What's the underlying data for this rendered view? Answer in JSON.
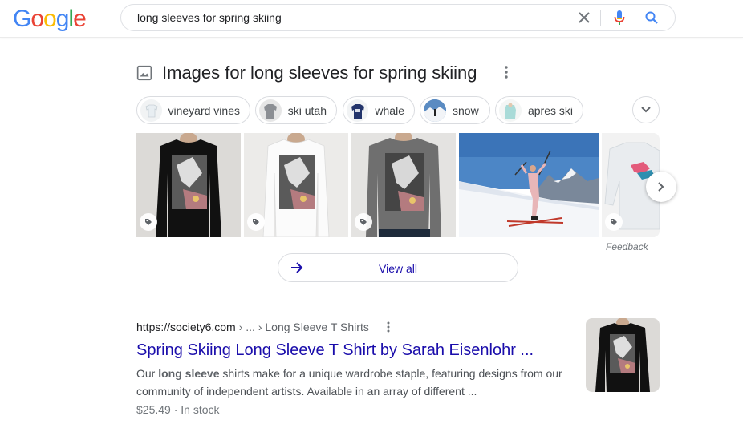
{
  "header": {
    "logo_text": "Google",
    "search_query": "long sleeves for spring skiing"
  },
  "images_section": {
    "title": "Images for long sleeves for spring skiing",
    "chips": [
      {
        "label": "vineyard vines"
      },
      {
        "label": "ski utah"
      },
      {
        "label": "whale"
      },
      {
        "label": "snow"
      },
      {
        "label": "apres ski"
      }
    ],
    "feedback_label": "Feedback",
    "view_all_label": "View all"
  },
  "result": {
    "url_domain": "https://society6.com",
    "url_crumbs": "› ... › Long Sleeve T Shirts",
    "title": "Spring Skiing Long Sleeve T Shirt by Sarah Eisenlohr ...",
    "snippet_prefix": "Our ",
    "snippet_bold": "long sleeve",
    "snippet_rest": " shirts make for a unique wardrobe staple, featuring designs from our community of independent artists. Available in an array of different ...",
    "meta": "$25.49 · In stock"
  },
  "colors": {
    "link": "#1a0dab",
    "brand_blue": "#4285f4",
    "brand_red": "#ea4335",
    "brand_yellow": "#fbbc05",
    "brand_green": "#34a853"
  }
}
